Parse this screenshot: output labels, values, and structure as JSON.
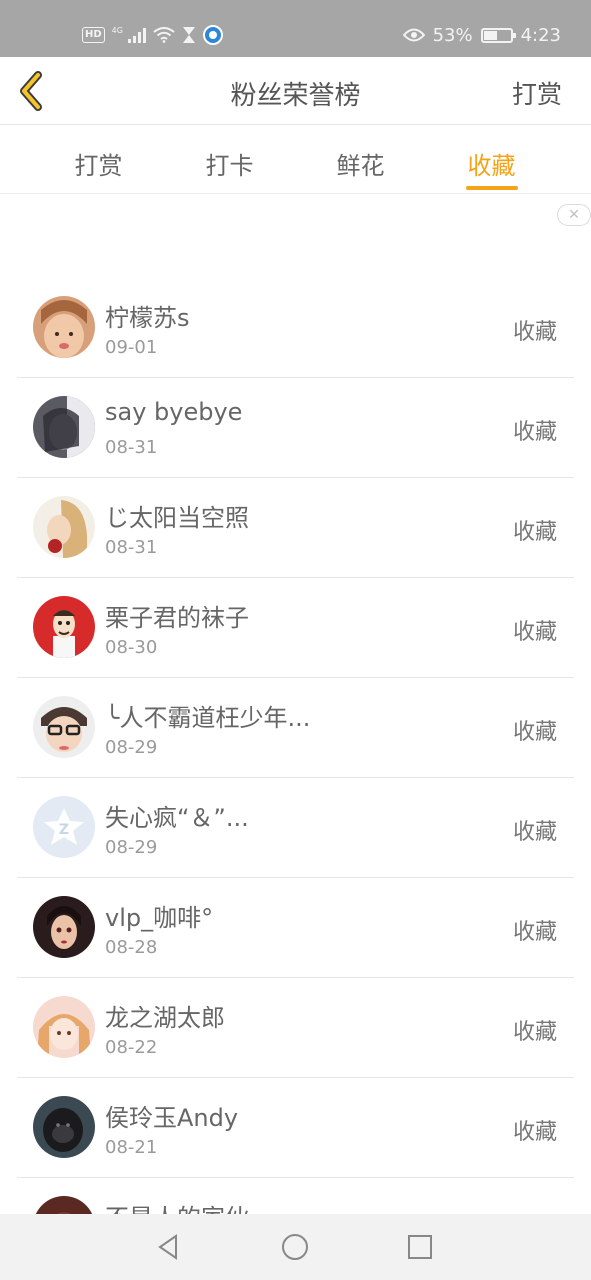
{
  "status_bar": {
    "hd": "HD",
    "network": "4G",
    "battery_percent": "53%",
    "battery_level": 0.53,
    "time": "4:23",
    "icons": [
      "hd-icon",
      "signal-icon",
      "wifi-icon",
      "hourglass-icon",
      "vpn-icon",
      "eye-icon",
      "battery-icon"
    ]
  },
  "nav": {
    "title": "粉丝荣誉榜",
    "action": "打赏",
    "back_icon": "chevron-left-icon"
  },
  "tabs": [
    {
      "label": "打赏",
      "active": false
    },
    {
      "label": "打卡",
      "active": false
    },
    {
      "label": "鲜花",
      "active": false
    },
    {
      "label": "收藏",
      "active": true
    }
  ],
  "accent_color": "#f5a31a",
  "close_label": "✕",
  "fans": [
    {
      "name": "柠檬苏s",
      "date": "09-01",
      "action": "收藏",
      "avatar": "girl-photo-avatar"
    },
    {
      "name": "say byebye",
      "date": "08-31",
      "action": "收藏",
      "avatar": "dark-anime-avatar"
    },
    {
      "name": "じ太阳当空照",
      "date": "08-31",
      "action": "收藏",
      "avatar": "blonde-girl-avatar"
    },
    {
      "name": "栗子君的袜子",
      "date": "08-30",
      "action": "收藏",
      "avatar": "red-cartoon-avatar"
    },
    {
      "name": "╰人不霸道枉少年...",
      "date": "08-29",
      "action": "收藏",
      "avatar": "glasses-avatar"
    },
    {
      "name": "失心疯“＆”...",
      "date": "08-29",
      "action": "收藏",
      "avatar": "default-qzone-avatar"
    },
    {
      "name": "vlp_咖啡°",
      "date": "08-28",
      "action": "收藏",
      "avatar": "dark-hair-girl-avatar"
    },
    {
      "name": "龙之湖太郎",
      "date": "08-22",
      "action": "收藏",
      "avatar": "anime-girl-avatar"
    },
    {
      "name": "侯玲玉Andy",
      "date": "08-21",
      "action": "收藏",
      "avatar": "gorilla-avatar"
    },
    {
      "name": "不是人的家伙",
      "date": "",
      "action": "",
      "avatar": "partial-avatar"
    }
  ],
  "system_nav": [
    "back-triangle-icon",
    "home-circle-icon",
    "recents-square-icon"
  ]
}
